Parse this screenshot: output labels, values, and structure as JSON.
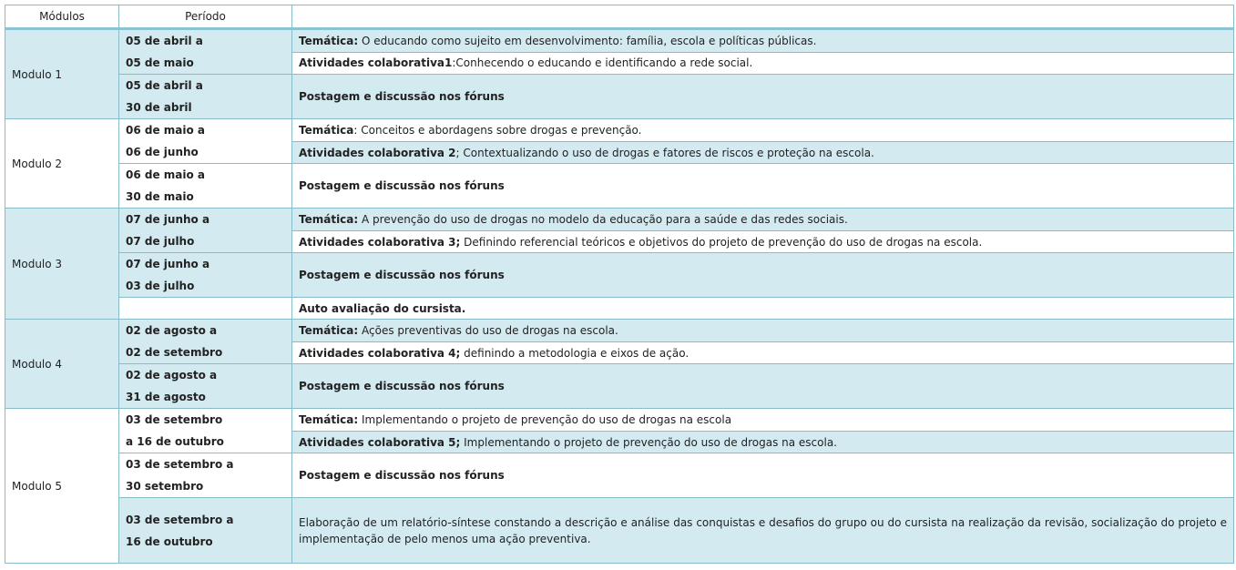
{
  "headers": {
    "modulos": "Módulos",
    "periodo": "Período",
    "conteudo": ""
  },
  "modules": [
    {
      "name": "Modulo 1",
      "rows": [
        {
          "period": [
            "05 de abril a",
            "05 de maio"
          ],
          "items": [
            {
              "bold": "Temática:",
              "text": " O educando como sujeito em desenvolvimento: família, escola e políticas públicas."
            },
            {
              "bold": "Atividades colaborativa1",
              "text": ":Conhecendo o educando e identificando a rede social."
            }
          ]
        },
        {
          "period": [
            "05 de abril a",
            "30 de abril"
          ],
          "items": [
            {
              "bold": "Postagem e discussão nos fóruns",
              "text": ""
            }
          ]
        }
      ]
    },
    {
      "name": "Modulo 2",
      "rows": [
        {
          "period": [
            "06 de maio a",
            "06 de junho"
          ],
          "items": [
            {
              "bold": "Temática",
              "text": ": Conceitos e abordagens sobre drogas e prevenção."
            },
            {
              "bold": "Atividades colaborativa 2",
              "text": "; Contextualizando o uso de drogas e fatores de riscos e proteção na escola."
            }
          ]
        },
        {
          "period": [
            "06 de maio a",
            "30 de maio"
          ],
          "items": [
            {
              "bold": "Postagem e discussão nos fóruns",
              "text": ""
            }
          ]
        }
      ]
    },
    {
      "name": "Modulo 3",
      "rows": [
        {
          "period": [
            "07 de junho a",
            "07 de julho"
          ],
          "items": [
            {
              "bold": "Temática:",
              "text": " A prevenção do uso de drogas no modelo da educação para a saúde e das redes sociais."
            },
            {
              "bold": "Atividades colaborativa 3;",
              "text": " Definindo referencial teóricos e objetivos do projeto de prevenção do uso de drogas na escola."
            }
          ]
        },
        {
          "period": [
            "07 de junho a",
            "03 de julho"
          ],
          "items": [
            {
              "bold": "Postagem e discussão nos fóruns",
              "text": ""
            }
          ]
        },
        {
          "period": [],
          "items": [
            {
              "bold": "Auto avaliação do cursista.",
              "text": ""
            }
          ]
        }
      ]
    },
    {
      "name": "Modulo 4",
      "rows": [
        {
          "period": [
            "02 de agosto a",
            "02 de setembro"
          ],
          "items": [
            {
              "bold": "Temática:",
              "text": " Ações preventivas do uso de drogas na escola."
            },
            {
              "bold": "Atividades colaborativa 4;",
              "text": " definindo a metodologia e eixos de ação."
            }
          ]
        },
        {
          "period": [
            "02 de agosto a",
            "31 de agosto"
          ],
          "items": [
            {
              "bold": "Postagem e discussão nos fóruns",
              "text": ""
            }
          ]
        }
      ]
    },
    {
      "name": "Modulo 5",
      "rows": [
        {
          "period": [
            "03 de setembro",
            "a 16 de outubro"
          ],
          "items": [
            {
              "bold": "Temática:",
              "text": " Implementando o projeto de prevenção do uso de drogas na escola"
            },
            {
              "bold": "Atividades colaborativa 5;",
              "text": " Implementando o projeto de prevenção do uso de drogas na escola."
            }
          ]
        },
        {
          "period": [
            "03 de setembro a",
            "30 setembro"
          ],
          "items": [
            {
              "bold": "Postagem e discussão nos fóruns",
              "text": ""
            }
          ]
        },
        {
          "period": [
            "03 de setembro a",
            "16 de outubro"
          ],
          "items": [
            {
              "bold": "",
              "text": "Elaboração de um relatório-síntese constando a descrição e análise das conquistas e desafios do grupo ou do cursista na realização da revisão, socialização do projeto e implementação de pelo menos uma ação preventiva."
            }
          ]
        }
      ]
    }
  ]
}
